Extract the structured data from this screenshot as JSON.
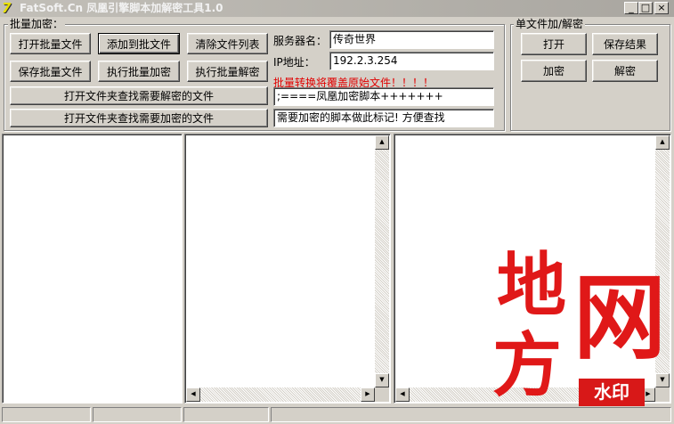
{
  "window": {
    "app_logo": "7",
    "title": "FatSoft.Cn  凤凰引擎脚本加解密工具1.0",
    "minimize_glyph": "_",
    "maximize_glyph": "□",
    "close_glyph": "×"
  },
  "batch": {
    "group_label": "批量加密：",
    "open_batch_label": "打开批量文件",
    "add_to_batch_label": "添加到批文件",
    "clear_list_label": "清除文件列表",
    "save_batch_label": "保存批量文件",
    "run_encrypt_label": "执行批量加密",
    "run_decrypt_label": "执行批量解密",
    "find_decrypt_label": "打开文件夹查找需要解密的文件",
    "find_encrypt_label": "打开文件夹查找需要加密的文件"
  },
  "server": {
    "name_label": "服务器名：",
    "name_value": "传奇世界",
    "ip_label": "IP地址：",
    "ip_value": "192.2.3.254",
    "warning": "批量转换将覆盖原始文件！！！！",
    "marker_value": ";====凤凰加密脚本+++++++",
    "marker_hint": "需要加密的脚本做此标记! 方便查找"
  },
  "single": {
    "group_label": "单文件加/解密",
    "open_label": "打开",
    "save_label": "保存结果",
    "encrypt_label": "加密",
    "decrypt_label": "解密"
  },
  "scroll": {
    "up": "▲",
    "down": "▼",
    "left": "◀",
    "right": "▶"
  },
  "watermark": {
    "char1": "地",
    "char2": "方",
    "char3": "网",
    "badge": "水印"
  },
  "colors": {
    "warning": "#e00000",
    "watermark": "#e01818"
  }
}
